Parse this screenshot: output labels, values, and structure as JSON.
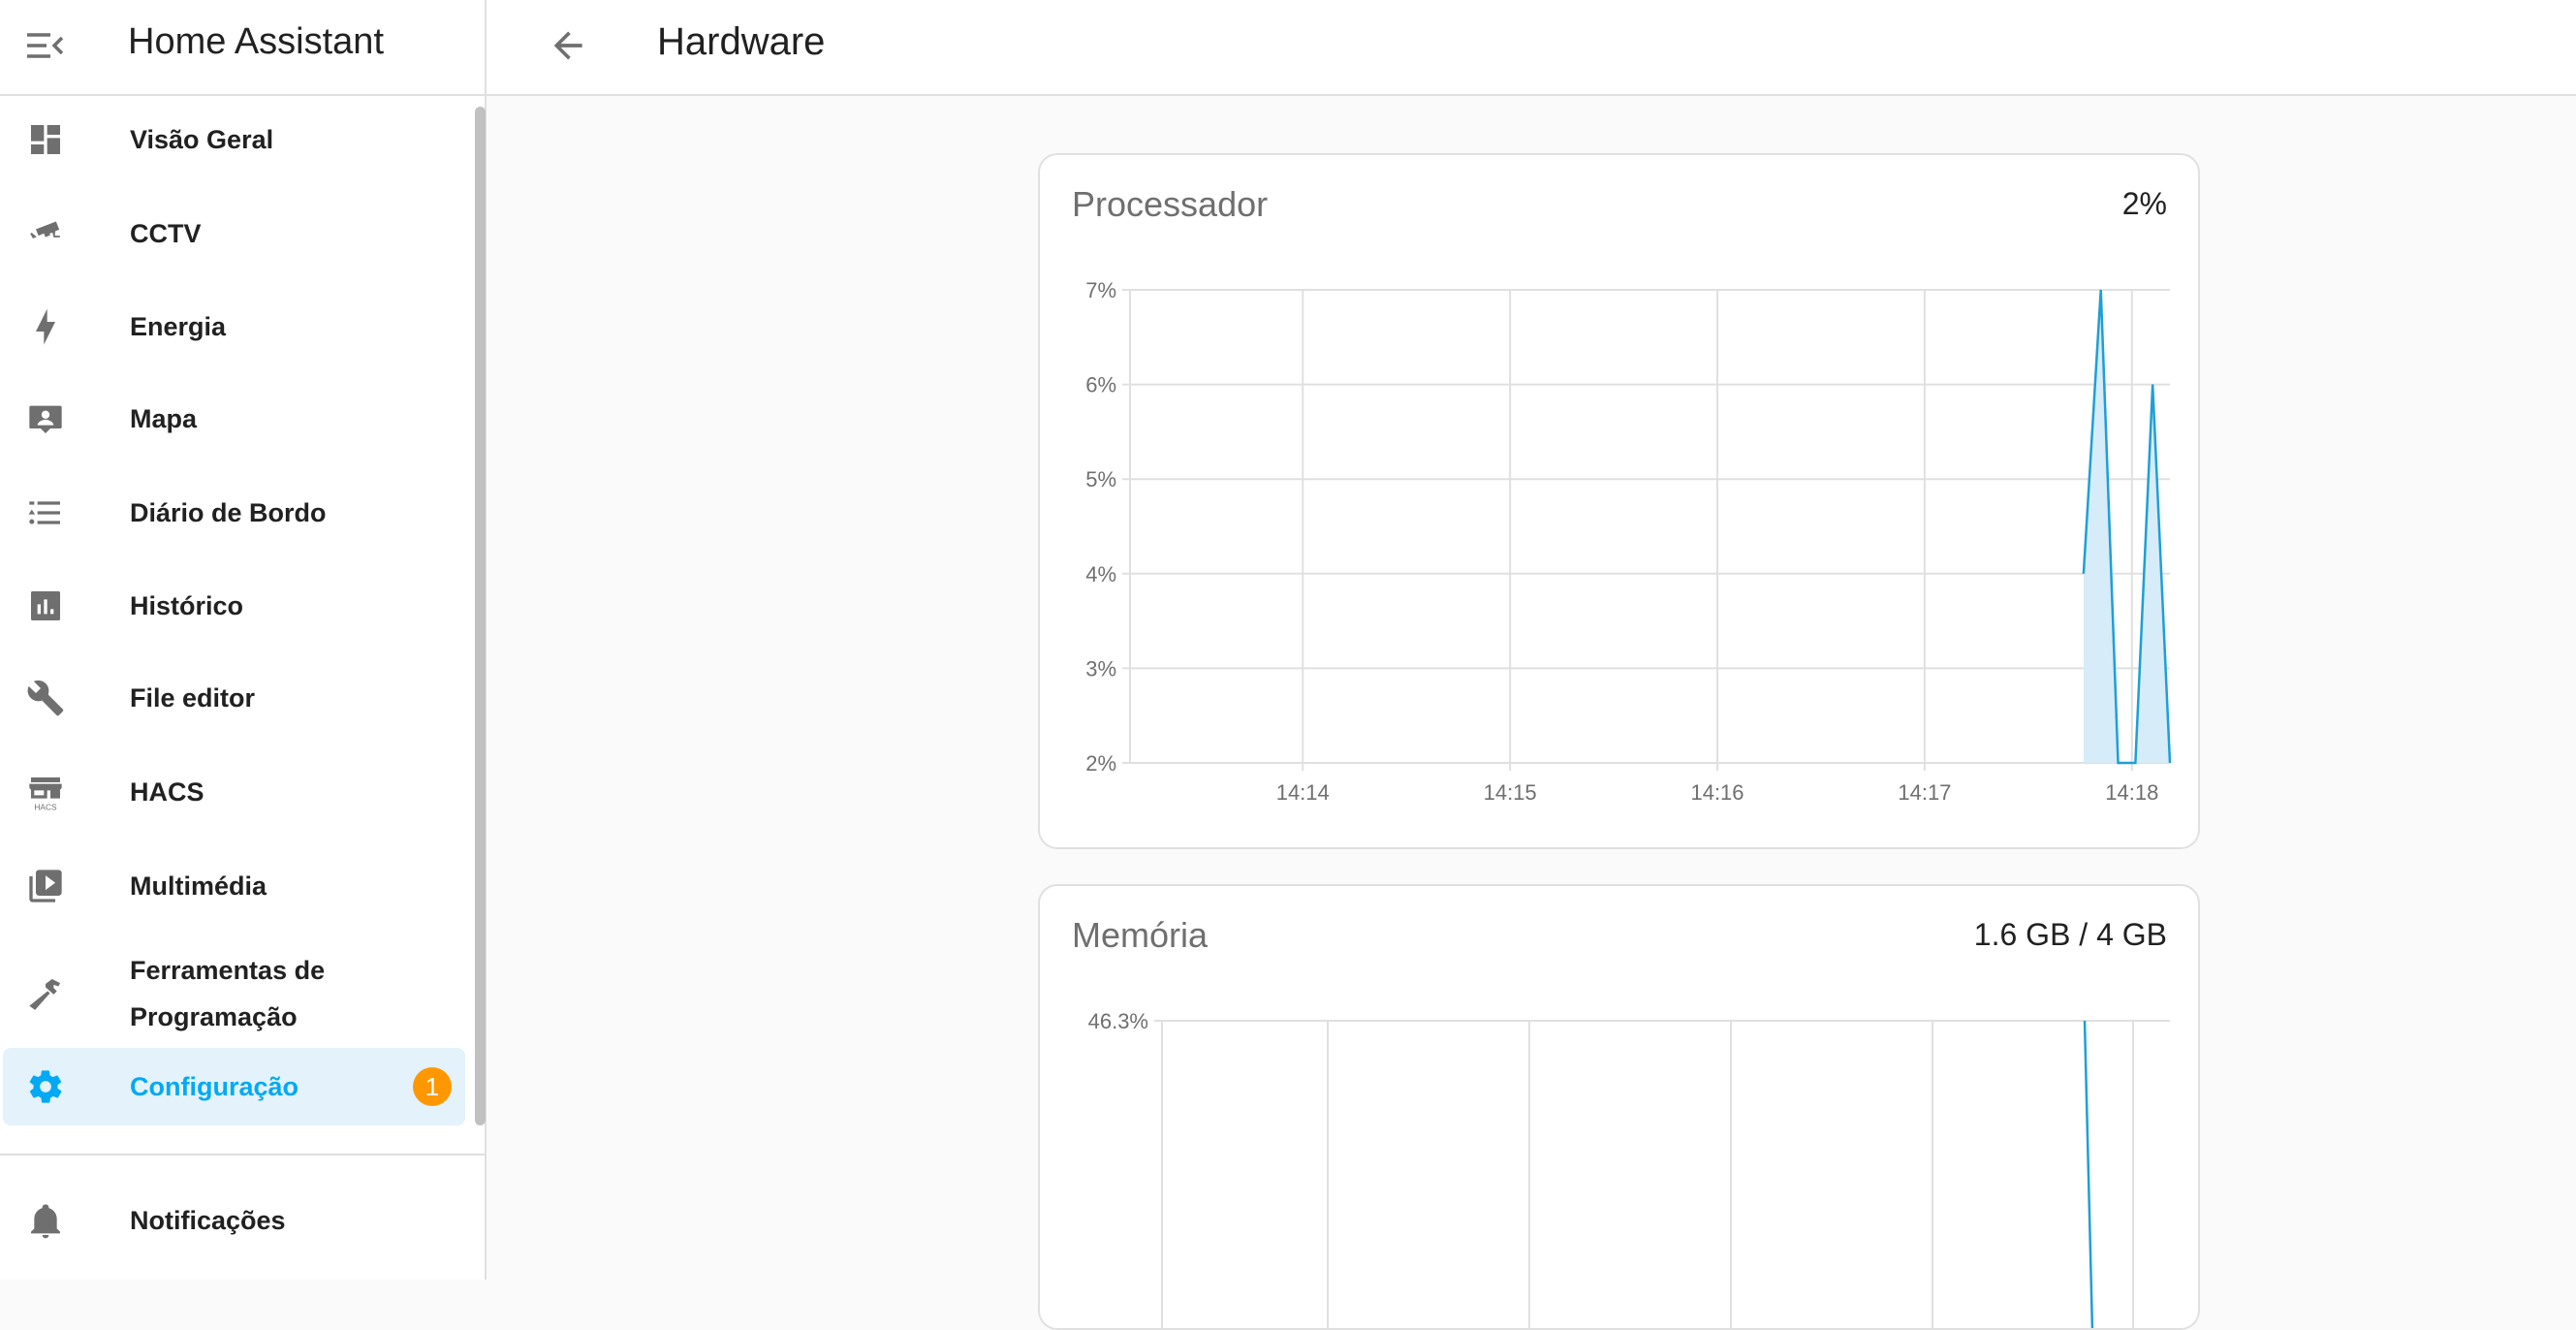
{
  "sidebar": {
    "title": "Home Assistant",
    "items": [
      {
        "label": "Visão Geral",
        "icon": "view-dashboard-icon"
      },
      {
        "label": "CCTV",
        "icon": "cctv-icon"
      },
      {
        "label": "Energia",
        "icon": "lightning-bolt-icon"
      },
      {
        "label": "Mapa",
        "icon": "account-box-map-icon"
      },
      {
        "label": "Diário de Bordo",
        "icon": "format-list-bulleted-icon"
      },
      {
        "label": "Histórico",
        "icon": "chart-box-icon"
      },
      {
        "label": "File editor",
        "icon": "wrench-icon"
      },
      {
        "label": "HACS",
        "icon": "hacs-store-icon"
      },
      {
        "label": "Multimédia",
        "icon": "play-box-multiple-icon"
      },
      {
        "label": "Ferramentas de Programação",
        "icon": "hammer-icon"
      },
      {
        "label": "Configuração",
        "icon": "cog-icon",
        "badge": "1",
        "active": true
      }
    ],
    "notifications": {
      "label": "Notificações",
      "icon": "bell-icon"
    }
  },
  "header": {
    "title": "Hardware"
  },
  "colors": {
    "accent": "#03a9f4",
    "badge": "#ff9800",
    "line": "#1e9fd6",
    "fill": "#d6ecf8"
  },
  "cards": {
    "cpu": {
      "title": "Processador",
      "value": "2%"
    },
    "memory": {
      "title": "Memória",
      "value": "1.6 GB / 4 GB"
    }
  },
  "chart_data": [
    {
      "type": "area",
      "title": "Processador",
      "ylim": [
        2,
        7
      ],
      "yticks": [
        "7%",
        "6%",
        "5%",
        "4%",
        "3%",
        "2%"
      ],
      "xticks": [
        "14:14",
        "14:15",
        "14:16",
        "14:17",
        "14:18"
      ],
      "x": [
        "14:17:46",
        "14:17:51",
        "14:17:56",
        "14:18:01",
        "14:18:06",
        "14:18:11"
      ],
      "values": [
        4,
        7,
        2,
        2,
        6,
        2
      ],
      "grid": true
    },
    {
      "type": "area",
      "title": "Memória",
      "yticks": [
        "46.3%"
      ],
      "x": [
        "14:17:46"
      ],
      "values": [
        46.3
      ],
      "grid": true
    }
  ]
}
